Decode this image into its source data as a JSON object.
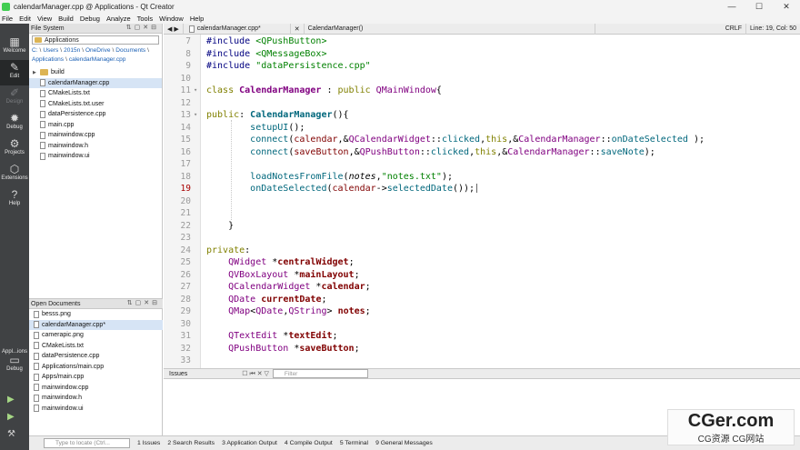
{
  "window": {
    "title": "calendarManager.cpp @ Applications - Qt Creator",
    "controls": [
      "minimize-icon",
      "maximize-icon",
      "close-icon"
    ]
  },
  "menu": [
    "File",
    "Edit",
    "View",
    "Build",
    "Debug",
    "Analyze",
    "Tools",
    "Window",
    "Help"
  ],
  "modes": [
    {
      "label": "Welcome",
      "icon": "welcome-icon",
      "glyph": "▦"
    },
    {
      "label": "Edit",
      "icon": "edit-icon",
      "glyph": "✎"
    },
    {
      "label": "Design",
      "icon": "design-icon",
      "glyph": "✐"
    },
    {
      "label": "Debug",
      "icon": "debug-icon",
      "glyph": "✹"
    },
    {
      "label": "Projects",
      "icon": "projects-icon",
      "glyph": "⚙"
    },
    {
      "label": "Extensions",
      "icon": "extensions-icon",
      "glyph": "⬡"
    },
    {
      "label": "Help",
      "icon": "help-icon",
      "glyph": "?"
    }
  ],
  "kit": {
    "label": "Appl...ions",
    "mode": "Debug"
  },
  "file_system": {
    "header": "File System",
    "root": "Applications",
    "breadcrumb": [
      "C:",
      "Users",
      "2015n",
      "OneDrive",
      "Documents",
      "Applications",
      "calendarManager.cpp"
    ],
    "items": [
      {
        "name": "build",
        "type": "folder"
      },
      {
        "name": "calendarManager.cpp",
        "type": "file",
        "selected": true
      },
      {
        "name": "CMakeLists.txt",
        "type": "file"
      },
      {
        "name": "CMakeLists.txt.user",
        "type": "file"
      },
      {
        "name": "dataPersistence.cpp",
        "type": "file"
      },
      {
        "name": "main.cpp",
        "type": "file"
      },
      {
        "name": "mainwindow.cpp",
        "type": "file"
      },
      {
        "name": "mainwindow.h",
        "type": "file"
      },
      {
        "name": "mainwindow.ui",
        "type": "file"
      }
    ]
  },
  "open_documents": {
    "header": "Open Documents",
    "items": [
      "besss.png",
      "calendarManager.cpp*",
      "camerapic.png",
      "CMakeLists.txt",
      "dataPersistence.cpp",
      "Applications/main.cpp",
      "Apps/main.cpp",
      "mainwindow.cpp",
      "mainwindow.h",
      "mainwindow.ui"
    ]
  },
  "editor_toolbar": {
    "file": "calendarManager.cpp*",
    "symbol": "CalendarManager()",
    "encoding": "CRLF",
    "position": "Line: 19, Col: 50"
  },
  "code_lines": [
    {
      "n": "7",
      "html": "<span class='mac'>#include</span> <span class='str'>&lt;QPushButton&gt;</span>"
    },
    {
      "n": "8",
      "html": "<span class='mac'>#include</span> <span class='str'>&lt;QMessageBox&gt;</span>"
    },
    {
      "n": "9",
      "html": "<span class='mac'>#include</span> <span class='str'>\"dataPersistence.cpp\"</span>"
    },
    {
      "n": "10",
      "html": ""
    },
    {
      "n": "11",
      "html": "<span class='kw'>class</span> <span class='cls bold'>CalendarManager</span> : <span class='kw'>public</span> <span class='typ'>QMainWindow</span>{",
      "fold": true
    },
    {
      "n": "12",
      "html": ""
    },
    {
      "n": "13",
      "html": "<span class='kw'>public</span>: <span class='fn bold'>CalendarManager</span>(){",
      "fold": true
    },
    {
      "n": "14",
      "html": "        <span class='fn'>setupUI</span>();"
    },
    {
      "n": "15",
      "html": "        <span class='fn'>connect</span>(<span class='mem'>calendar</span>,&amp;<span class='typ'>QCalendarWidget</span>::<span class='fn'>clicked</span>,<span class='kw'>this</span>,&amp;<span class='typ'>CalendarManager</span>::<span class='fn'>onDateSelected</span> );"
    },
    {
      "n": "16",
      "html": "        <span class='fn'>connect</span>(<span class='mem'>saveButton</span>,&amp;<span class='typ'>QPushButton</span>::<span class='fn'>clicked</span>,<span class='kw'>this</span>,&amp;<span class='typ'>CalendarManager</span>::<span class='fn'>saveNote</span>);"
    },
    {
      "n": "17",
      "html": ""
    },
    {
      "n": "18",
      "html": "        <span class='fn'>loadNotesFromFile</span>(<span class='it'>notes</span>,<span class='str'>\"notes.txt\"</span>);"
    },
    {
      "n": "19",
      "html": "        <span class='fn'>onDateSelected</span>(<span class='mem'>calendar</span>-&gt;<span class='fn'>selectedDate</span>());",
      "cur": true
    },
    {
      "n": "20",
      "html": ""
    },
    {
      "n": "21",
      "html": ""
    },
    {
      "n": "22",
      "html": "    }"
    },
    {
      "n": "23",
      "html": ""
    },
    {
      "n": "24",
      "html": "<span class='kw'>private</span>:"
    },
    {
      "n": "25",
      "html": "    <span class='typ'>QWidget</span> *<span class='mem bold'>centralWidget</span>;"
    },
    {
      "n": "26",
      "html": "    <span class='typ'>QVBoxLayout</span> *<span class='mem bold'>mainLayout</span>;"
    },
    {
      "n": "27",
      "html": "    <span class='typ'>QCalendarWidget</span> *<span class='mem bold'>calendar</span>;"
    },
    {
      "n": "28",
      "html": "    <span class='typ'>QDate</span> <span class='mem bold'>currentDate</span>;"
    },
    {
      "n": "29",
      "html": "    <span class='typ'>QMap</span>&lt;<span class='typ'>QDate</span>,<span class='typ'>QString</span>&gt; <span class='mem bold'>notes</span>;"
    },
    {
      "n": "30",
      "html": ""
    },
    {
      "n": "31",
      "html": "    <span class='typ'>QTextEdit</span> *<span class='mem bold'>textEdit</span>;"
    },
    {
      "n": "32",
      "html": "    <span class='typ'>QPushButton</span> *<span class='mem bold'>saveButton</span>;"
    },
    {
      "n": "33",
      "html": ""
    }
  ],
  "issues": {
    "label": "Issues",
    "filter_placeholder": "Filter"
  },
  "status": {
    "locator_placeholder": "Type to locate (Ctrl...",
    "panes": [
      "1 Issues",
      "2 Search Results",
      "3 Application Output",
      "4 Compile Output",
      "5 Terminal",
      "9 General Messages"
    ]
  },
  "watermark": {
    "line1": "CGer.com",
    "line2": "CG资源 CG网站"
  }
}
